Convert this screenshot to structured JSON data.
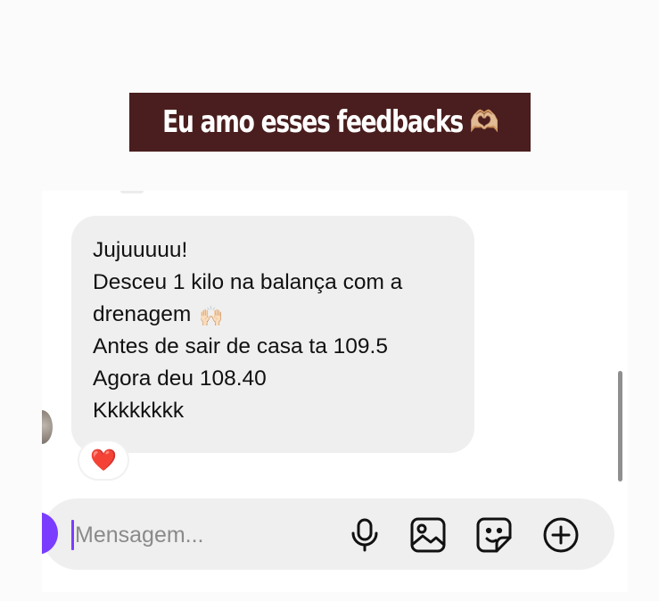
{
  "banner": {
    "text": "Eu amo esses feedbacks 🫶🏼"
  },
  "message": {
    "lines": [
      "Jujuuuuu!",
      "Desceu 1 kilo na balança com a",
      "drenagem",
      "Antes de sair de casa ta 109.5",
      "Agora deu 108.40",
      "Kkkkkkkk"
    ],
    "inline_emoji": "🙌🏻",
    "reaction": "❤️"
  },
  "composer": {
    "placeholder": "Mensagem...",
    "icons": [
      "microphone-icon",
      "image-gallery-icon",
      "sticker-icon",
      "add-circle-icon"
    ]
  },
  "colors": {
    "banner_bg": "#4a1e1e",
    "bubble_bg": "#efefef",
    "accent": "#7a3dff",
    "reaction_heart": "#e0192f"
  }
}
